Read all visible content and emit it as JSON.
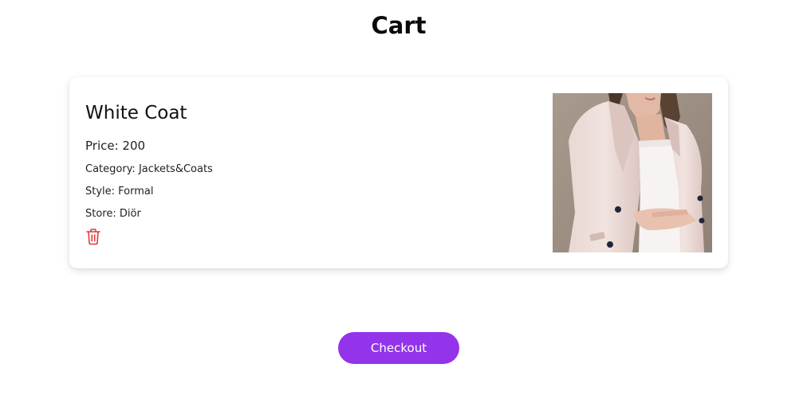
{
  "header": {
    "title": "Cart"
  },
  "cart": {
    "items": [
      {
        "name": "White Coat",
        "price_text": "Price: 200",
        "category_text": "Category: Jackets&Coats",
        "style_text": "Style: Formal",
        "store_text": "Store: Diör",
        "delete_icon": "trash-icon",
        "image_subject": "product photo of a woman wearing a pale pink coat"
      }
    ]
  },
  "actions": {
    "checkout_label": "Checkout"
  },
  "colors": {
    "accent": "#9333ea",
    "delete": "#e03b3b",
    "card_background": "#ffffff"
  }
}
